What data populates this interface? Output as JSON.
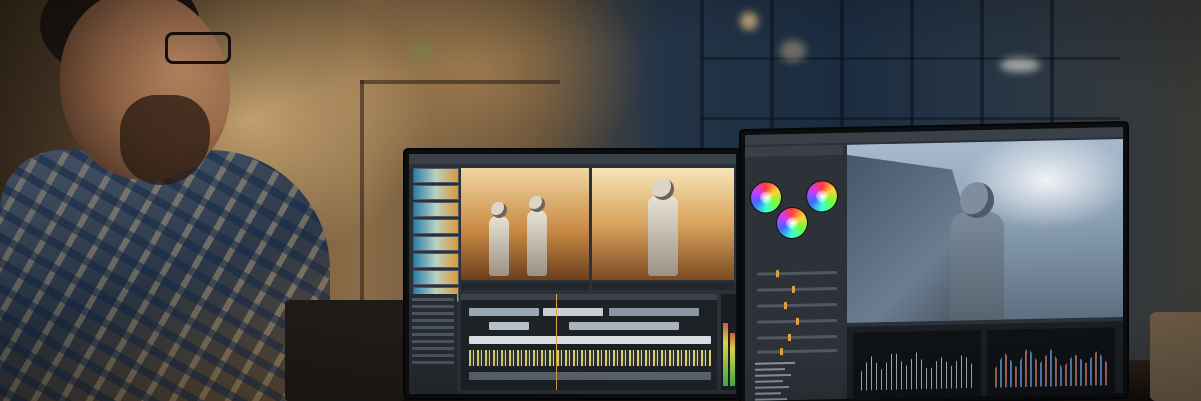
{
  "scene": {
    "description_colors": {
      "warm_light": "#f1c98a",
      "cool_window": "#1f3347",
      "screen_bg": "#2b3138",
      "accent": "#e0a040"
    }
  },
  "left_monitor": {
    "app": "video-editor",
    "thumbnail_count": 8,
    "meter_levels": [
      0.72,
      0.6
    ]
  },
  "right_monitor": {
    "app": "color-grading",
    "color_wheel_count": 3,
    "slider_levels": [
      0.25,
      0.45,
      0.35,
      0.5,
      0.4,
      0.3
    ],
    "list_lines": 8
  }
}
